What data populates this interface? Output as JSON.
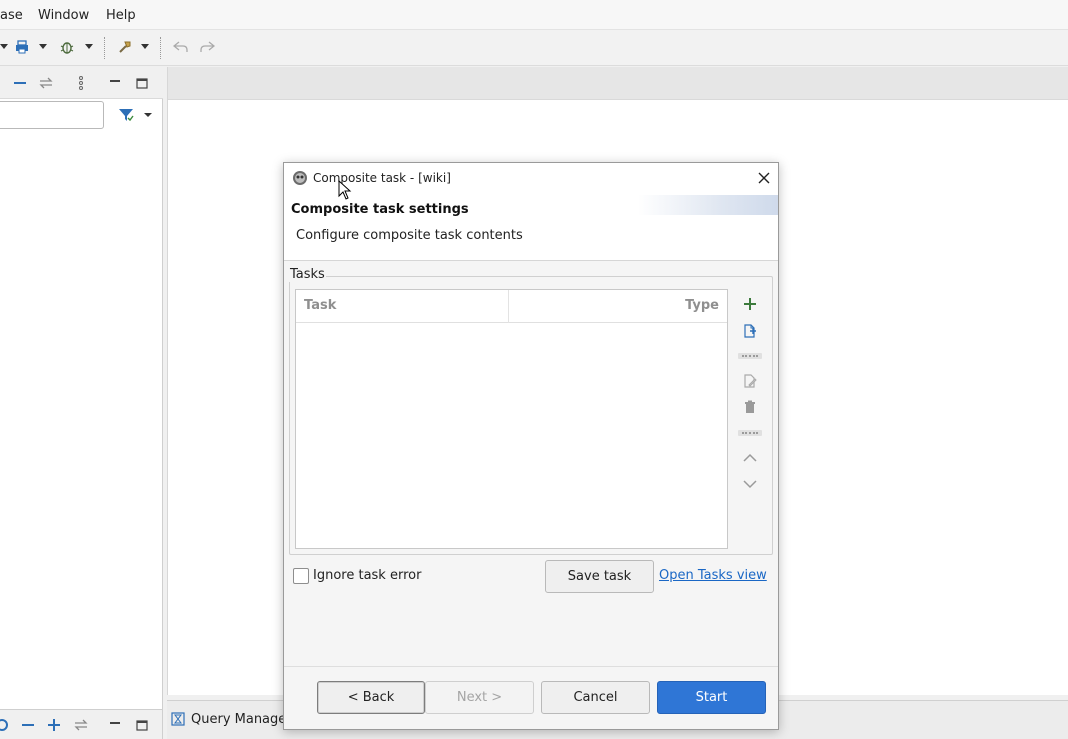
{
  "menubar": {
    "items": [
      "ase",
      "Window",
      "Help"
    ]
  },
  "toolbar": {
    "icons": [
      "dropdown-arrow-icon",
      "print-icon",
      "bug-icon",
      "hammer-icon",
      "back-nav-icon",
      "forward-nav-icon"
    ]
  },
  "left_panel": {
    "header_icons": [
      "collapse-icon",
      "link-icon",
      "more-icon",
      "minimize-icon",
      "maximize-icon"
    ],
    "filter_icon": "filter-icon"
  },
  "bottom_panel": {
    "tab_label": "Query Manage"
  },
  "dialog": {
    "title": "Composite task - [wiki]",
    "header_title": "Composite task settings",
    "header_description": "Configure composite task contents",
    "group_label": "Tasks",
    "table": {
      "columns": [
        "Task",
        "Type"
      ],
      "rows": []
    },
    "ignore_label": "Ignore task error",
    "ignore_checked": false,
    "save_task_label": "Save task",
    "open_tasks_link": "Open Tasks view",
    "back_label": "< Back",
    "next_label": "Next >",
    "cancel_label": "Cancel",
    "start_label": "Start"
  },
  "colors": {
    "accent": "#2f76d6",
    "link": "#1a67c5",
    "add_green": "#3c7a3c"
  }
}
